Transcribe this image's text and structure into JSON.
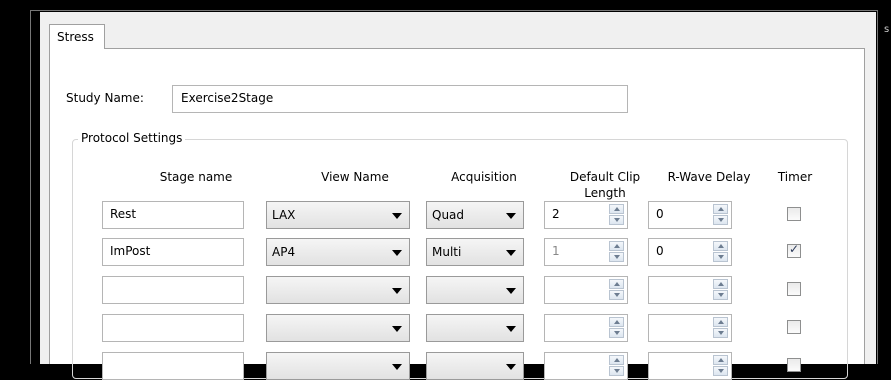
{
  "tab": {
    "label": "Stress"
  },
  "study": {
    "label": "Study Name:",
    "value": "Exercise2Stage"
  },
  "protocol": {
    "label": "Protocol Settings",
    "headers": {
      "stage": "Stage name",
      "view": "View Name",
      "acq": "Acquisition",
      "clip_line1": "Default Clip",
      "clip_line2": "Length",
      "rwave": "R-Wave Delay",
      "timer": "Timer"
    },
    "rows": [
      {
        "stage": "Rest",
        "view": "LAX",
        "acq": "Quad",
        "clip": "2",
        "clip_enabled": true,
        "rwave": "0",
        "timer": false
      },
      {
        "stage": "ImPost",
        "view": "AP4",
        "acq": "Multi",
        "clip": "1",
        "clip_enabled": false,
        "rwave": "0",
        "timer": true
      },
      {
        "stage": "",
        "view": "",
        "acq": "",
        "clip": "",
        "clip_enabled": true,
        "rwave": "",
        "timer": false
      },
      {
        "stage": "",
        "view": "",
        "acq": "",
        "clip": "",
        "clip_enabled": true,
        "rwave": "",
        "timer": false
      },
      {
        "stage": "",
        "view": "",
        "acq": "",
        "clip": "",
        "clip_enabled": true,
        "rwave": "",
        "timer": false
      }
    ]
  },
  "window_glyph": "s"
}
